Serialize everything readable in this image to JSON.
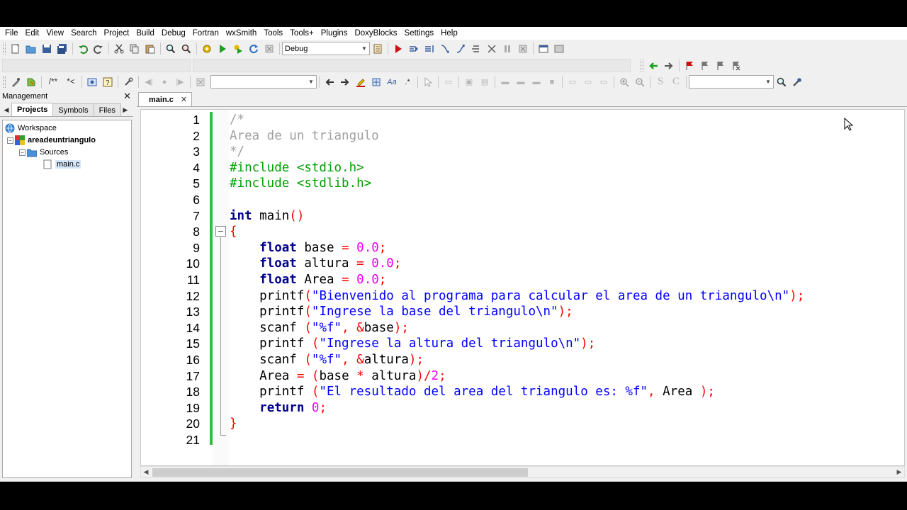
{
  "menubar": {
    "items": [
      "File",
      "Edit",
      "View",
      "Search",
      "Project",
      "Build",
      "Debug",
      "Fortran",
      "wxSmith",
      "Tools",
      "Tools+",
      "Plugins",
      "DoxyBlocks",
      "Settings",
      "Help"
    ]
  },
  "toolbar": {
    "build_target": "Debug",
    "comment_block": "/**",
    "comment_line": "*<"
  },
  "management": {
    "title": "Management",
    "tabs": [
      "Projects",
      "Symbols",
      "Files"
    ],
    "active_tab": "Projects",
    "tree": {
      "workspace": "Workspace",
      "project": "areadeuntriangulo",
      "folder": "Sources",
      "file": "main.c"
    }
  },
  "editor": {
    "tab_label": "main.c",
    "lines": [
      {
        "n": "1",
        "t": "/*"
      },
      {
        "n": "2",
        "t": "Area de un triangulo"
      },
      {
        "n": "3",
        "t": "*/"
      },
      {
        "n": "4",
        "t": "#include <stdio.h>"
      },
      {
        "n": "5",
        "t": "#include <stdlib.h>"
      },
      {
        "n": "6",
        "t": ""
      },
      {
        "n": "7",
        "t": "int main()"
      },
      {
        "n": "8",
        "t": "{"
      },
      {
        "n": "9",
        "t": "    float base = 0.0;"
      },
      {
        "n": "10",
        "t": "    float altura = 0.0;"
      },
      {
        "n": "11",
        "t": "    float Area = 0.0;"
      },
      {
        "n": "12",
        "t": "    printf(\"Bienvenido al programa para calcular el area de un triangulo\\n\");"
      },
      {
        "n": "13",
        "t": "    printf(\"Ingrese la base del triangulo\\n\");"
      },
      {
        "n": "14",
        "t": "    scanf (\"%f\", &base);"
      },
      {
        "n": "15",
        "t": "    printf (\"Ingrese la altura del triangulo\\n\");"
      },
      {
        "n": "16",
        "t": "    scanf (\"%f\", &altura);"
      },
      {
        "n": "17",
        "t": "    Area = (base * altura)/2;"
      },
      {
        "n": "18",
        "t": "    printf (\"El resultado del area del triangulo es: %f\", Area );"
      },
      {
        "n": "19",
        "t": "    return 0;"
      },
      {
        "n": "20",
        "t": "}"
      },
      {
        "n": "21",
        "t": ""
      }
    ]
  },
  "colors": {
    "comment": "#a0a0a0",
    "preprocessor": "#00a000",
    "keyword": "#00008b",
    "number": "#f000f0",
    "string": "#0000ff",
    "operator": "#ff0000",
    "change_bar": "#2fbf3f"
  }
}
